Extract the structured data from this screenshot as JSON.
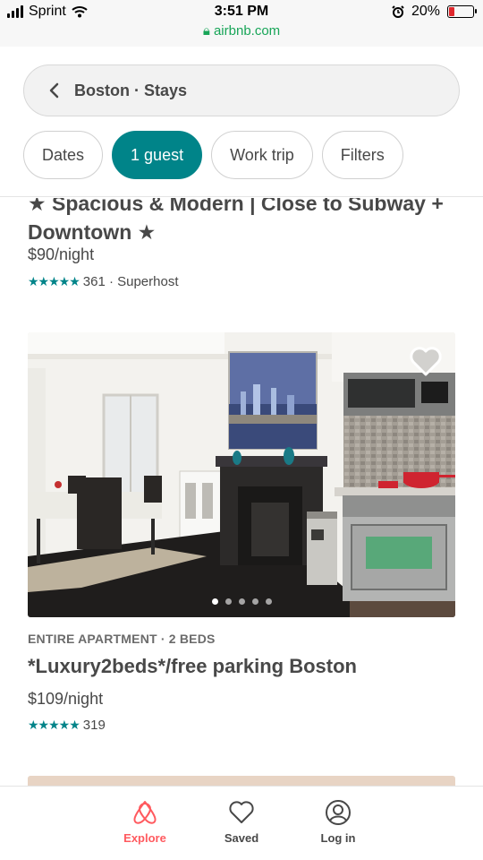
{
  "status_bar": {
    "carrier": "Sprint",
    "time": "3:51 PM",
    "url": "airbnb.com",
    "battery_percent": "20%",
    "battery_level": 0.2
  },
  "search": {
    "text": "Boston · Stays"
  },
  "filters": [
    {
      "label": "Dates"
    },
    {
      "label": "1 guest",
      "active": true
    },
    {
      "label": "Work trip"
    },
    {
      "label": "Filters"
    }
  ],
  "listings": [
    {
      "title_line1": "★ Spacious & Modern | Close to Subway +",
      "title_line2": "Downtown ★",
      "price": "$90/night",
      "rating_stars": "★★★★★",
      "rating_text": "361 · Superhost"
    },
    {
      "type": "ENTIRE APARTMENT · 2 BEDS",
      "title": "*Luxury2beds*/free parking Boston",
      "price": "$109/night",
      "rating_stars": "★★★★★",
      "rating_text": "319",
      "photo_count": 5,
      "photo_index": 1
    }
  ],
  "nav": {
    "explore": "Explore",
    "saved": "Saved",
    "login": "Log in"
  },
  "colors": {
    "teal": "#008489",
    "brand": "#ff5a5f",
    "url_green": "#18a558"
  }
}
